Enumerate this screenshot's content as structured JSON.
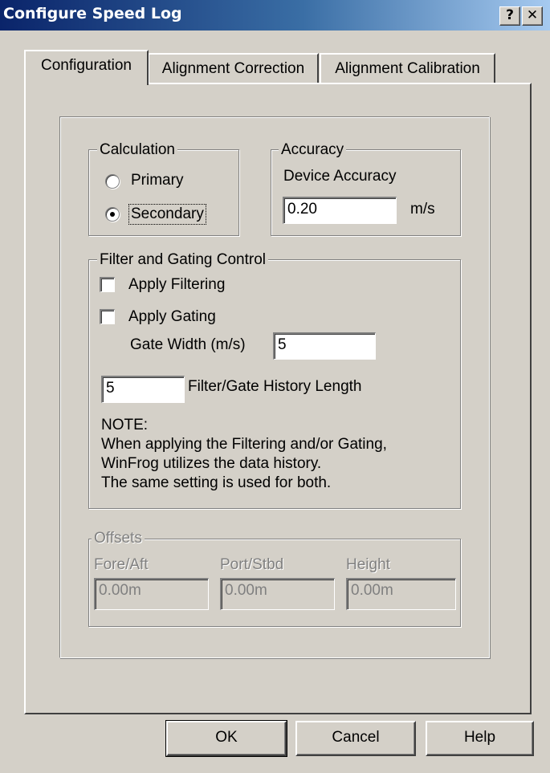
{
  "window": {
    "title": "Configure Speed Log",
    "help_button": "?",
    "close_button": "✕"
  },
  "tabs": [
    {
      "label": "Configuration",
      "active": true
    },
    {
      "label": "Alignment Correction",
      "active": false
    },
    {
      "label": "Alignment Calibration",
      "active": false
    }
  ],
  "calculation": {
    "legend": "Calculation",
    "options": [
      {
        "label": "Primary",
        "selected": false
      },
      {
        "label": "Secondary",
        "selected": true
      }
    ]
  },
  "accuracy": {
    "legend": "Accuracy",
    "device_label": "Device Accuracy",
    "value": "0.20",
    "unit": "m/s"
  },
  "filter": {
    "legend": "Filter and Gating Control",
    "apply_filtering_label": "Apply Filtering",
    "apply_filtering_checked": false,
    "apply_gating_label": "Apply Gating",
    "apply_gating_checked": false,
    "gate_width_label": "Gate Width (m/s)",
    "gate_width_value": "5",
    "history_value": "5",
    "history_label": "Filter/Gate History Length",
    "note_title": "NOTE:",
    "note_lines": [
      "When applying the Filtering and/or Gating,",
      "WinFrog utilizes the data history.",
      "The same setting is used for both."
    ]
  },
  "offsets": {
    "legend": "Offsets",
    "fields": [
      {
        "label": "Fore/Aft",
        "value": "0.00m"
      },
      {
        "label": "Port/Stbd",
        "value": "0.00m"
      },
      {
        "label": "Height",
        "value": "0.00m"
      }
    ]
  },
  "buttons": {
    "ok": "OK",
    "cancel": "Cancel",
    "help": "Help"
  }
}
